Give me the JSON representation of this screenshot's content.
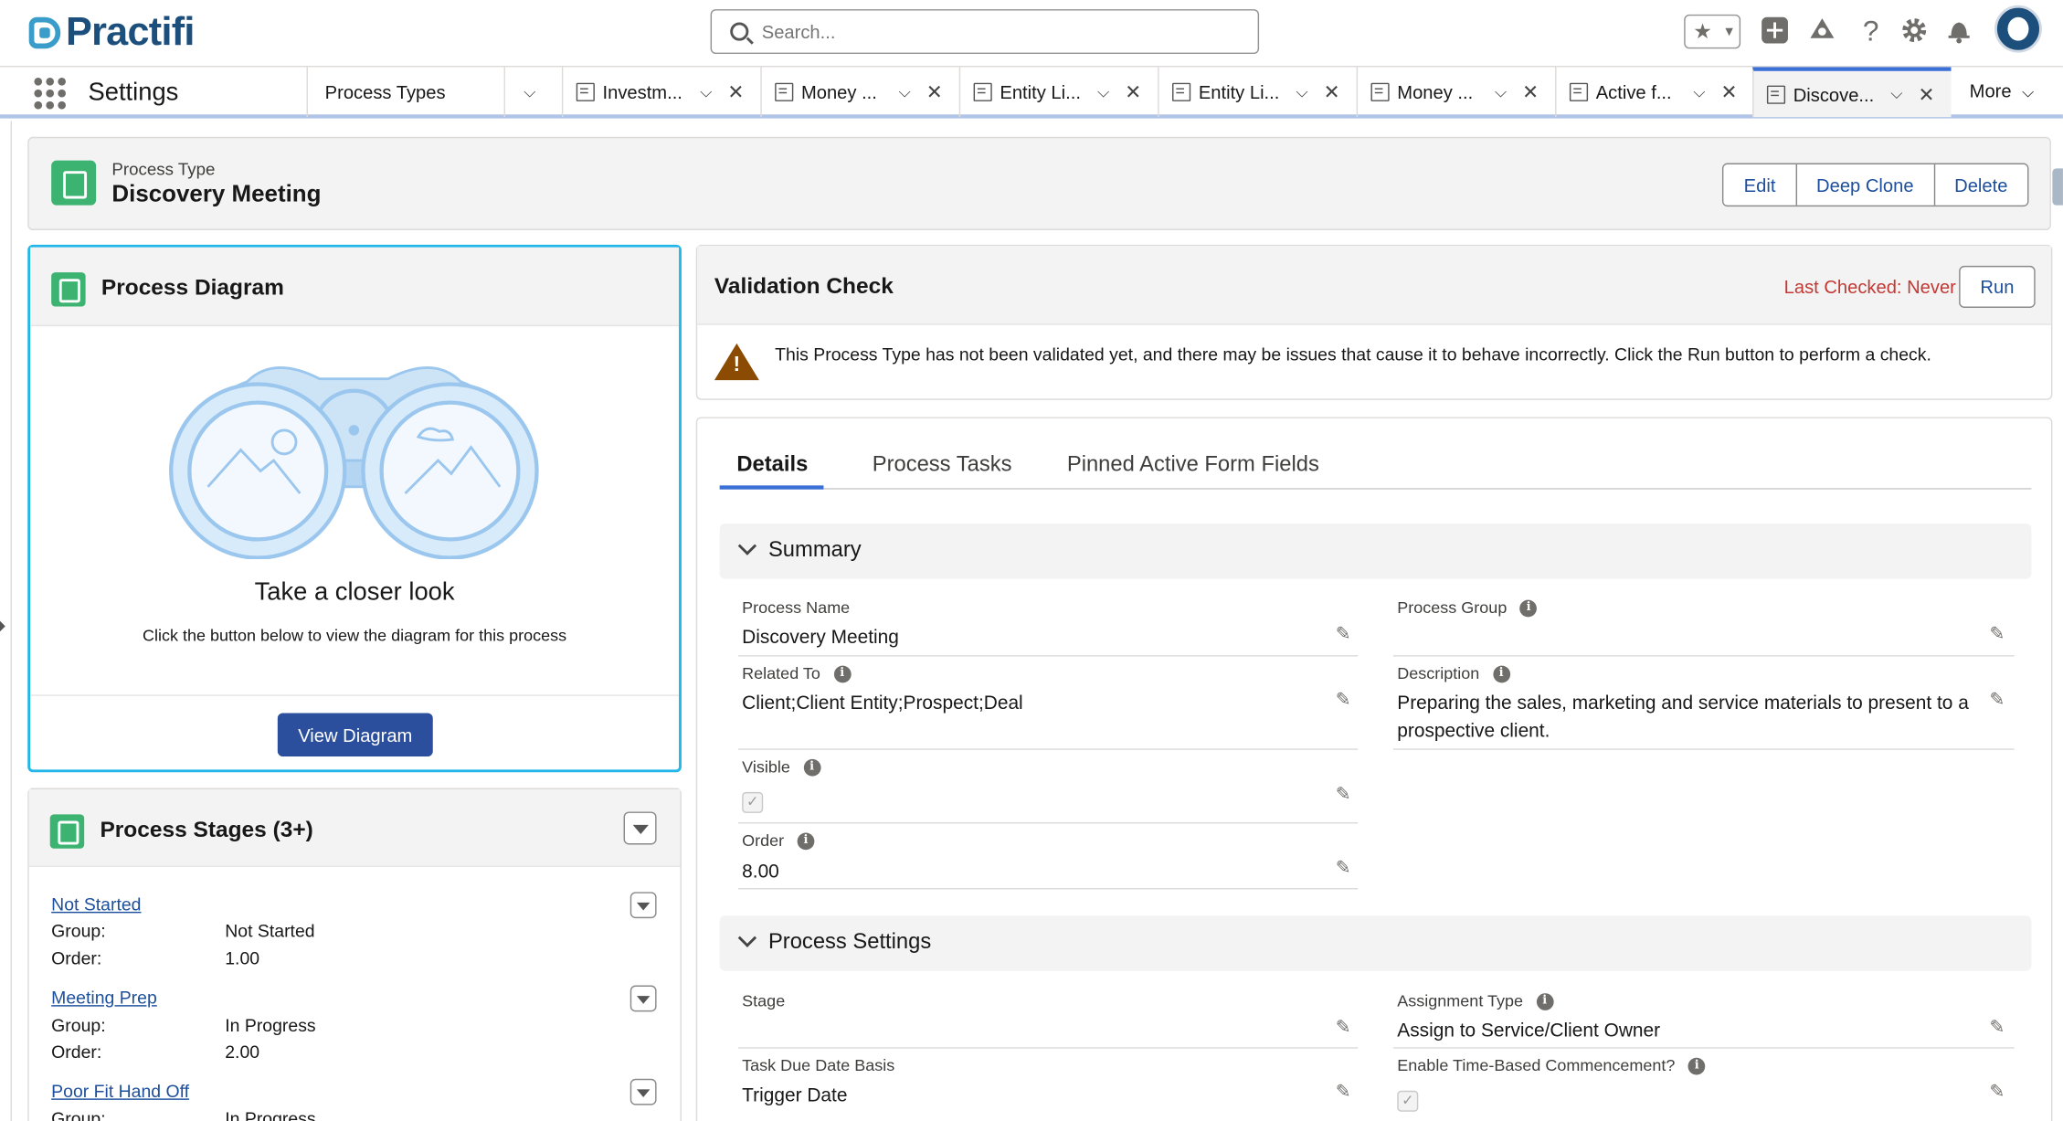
{
  "header": {
    "logo_text": "Practifi",
    "search_placeholder": "Search..."
  },
  "nav": {
    "app_name": "Settings",
    "tabs": [
      {
        "label": "Process Types"
      },
      {
        "label": "Investm..."
      },
      {
        "label": "Money ..."
      },
      {
        "label": "Entity Li..."
      },
      {
        "label": "Entity Li..."
      },
      {
        "label": "Money ..."
      },
      {
        "label": "Active f..."
      },
      {
        "label": "Discove..."
      }
    ],
    "more_label": "More"
  },
  "record": {
    "type_label": "Process Type",
    "title": "Discovery Meeting",
    "buttons": {
      "edit": "Edit",
      "deep_clone": "Deep Clone",
      "delete": "Delete"
    }
  },
  "diagram": {
    "title": "Process Diagram",
    "heading": "Take a closer look",
    "subtext": "Click the button below to view the diagram for this process",
    "button": "View Diagram"
  },
  "stages": {
    "title": "Process Stages (3+)",
    "group_label": "Group:",
    "order_label": "Order:",
    "items": [
      {
        "name": "Not Started",
        "group": "Not Started",
        "order": "1.00"
      },
      {
        "name": "Meeting Prep",
        "group": "In Progress",
        "order": "2.00"
      },
      {
        "name": "Poor Fit Hand Off",
        "group": "In Progress"
      }
    ]
  },
  "validation": {
    "title": "Validation Check",
    "last_checked": "Last Checked: Never",
    "run_button": "Run",
    "message": "This Process Type has not been validated yet, and there may be issues that cause it to behave incorrectly. Click the Run button to perform a check."
  },
  "details": {
    "tabs": [
      "Details",
      "Process Tasks",
      "Pinned Active Form Fields"
    ],
    "summary": {
      "title": "Summary",
      "process_name_label": "Process Name",
      "process_name": "Discovery Meeting",
      "process_group_label": "Process Group",
      "process_group": "",
      "related_to_label": "Related To",
      "related_to": "Client;Client Entity;Prospect;Deal",
      "description_label": "Description",
      "description": "Preparing the sales, marketing and service materials to present to a prospective client.",
      "visible_label": "Visible",
      "visible": true,
      "order_label": "Order",
      "order": "8.00"
    },
    "process_settings": {
      "title": "Process Settings",
      "stage_label": "Stage",
      "stage": "",
      "assignment_type_label": "Assignment Type",
      "assignment_type": "Assign to Service/Client Owner",
      "task_due_label": "Task Due Date Basis",
      "task_due": "Trigger Date",
      "time_based_label": "Enable Time-Based Commencement?",
      "time_based": true
    }
  },
  "colors": {
    "brand": "#1d4f7c",
    "accent": "#3a6fd6",
    "button_primary": "#2b4f9c",
    "warning": "#8c4b02",
    "error_text": "#c23934",
    "icon_green": "#3cb371"
  }
}
